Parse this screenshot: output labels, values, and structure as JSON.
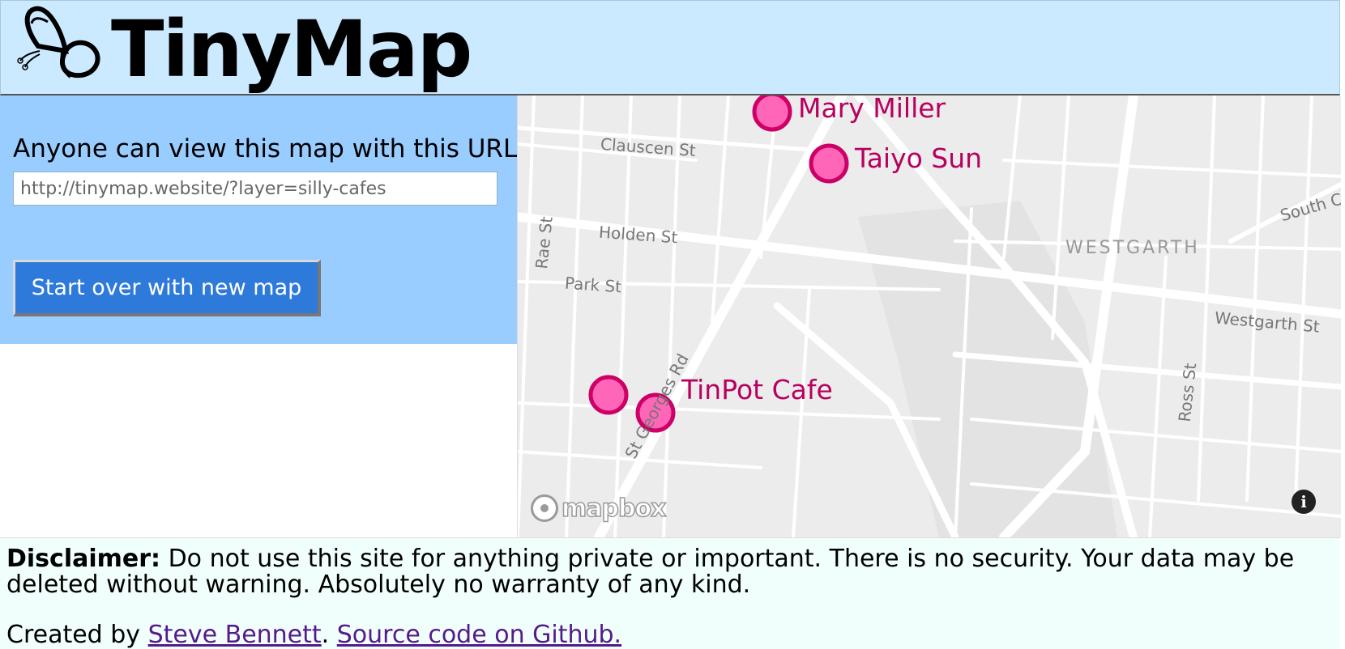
{
  "header": {
    "title": "TinyMap",
    "logo_icon": "butterfly-icon"
  },
  "panel": {
    "url_label": "Anyone can view this map with this URL:",
    "url_value": "http://tinymap.website/?layer=silly-cafes",
    "start_over_label": "Start over with new map"
  },
  "map": {
    "markers": [
      {
        "label": "Mary Miller"
      },
      {
        "label": "Taiyo Sun"
      },
      {
        "label": ""
      },
      {
        "label": "TinPot Cafe"
      }
    ],
    "streets": {
      "clauscen": "Clauscen St",
      "holden": "Holden St",
      "park": "Park St",
      "rae": "Rae St",
      "st_georges": "St Georges Rd",
      "westgarth_st": "Westgarth St",
      "ross": "Ross St",
      "south_c": "South C"
    },
    "district": "WESTGARTH",
    "attribution": "mapbox",
    "info_icon": "info-icon",
    "marker_color": "#ff66b8",
    "marker_stroke": "#cc0066"
  },
  "footer": {
    "disclaimer_label": "Disclaimer:",
    "disclaimer_text": " Do not use this site for anything private or important. There is no security. Your data may be deleted without warning. Absolutely no warranty of any kind.",
    "created_by": "Created by ",
    "author_link": "Steve Bennett",
    "separator": ". ",
    "source_link": "Source code on Github."
  }
}
